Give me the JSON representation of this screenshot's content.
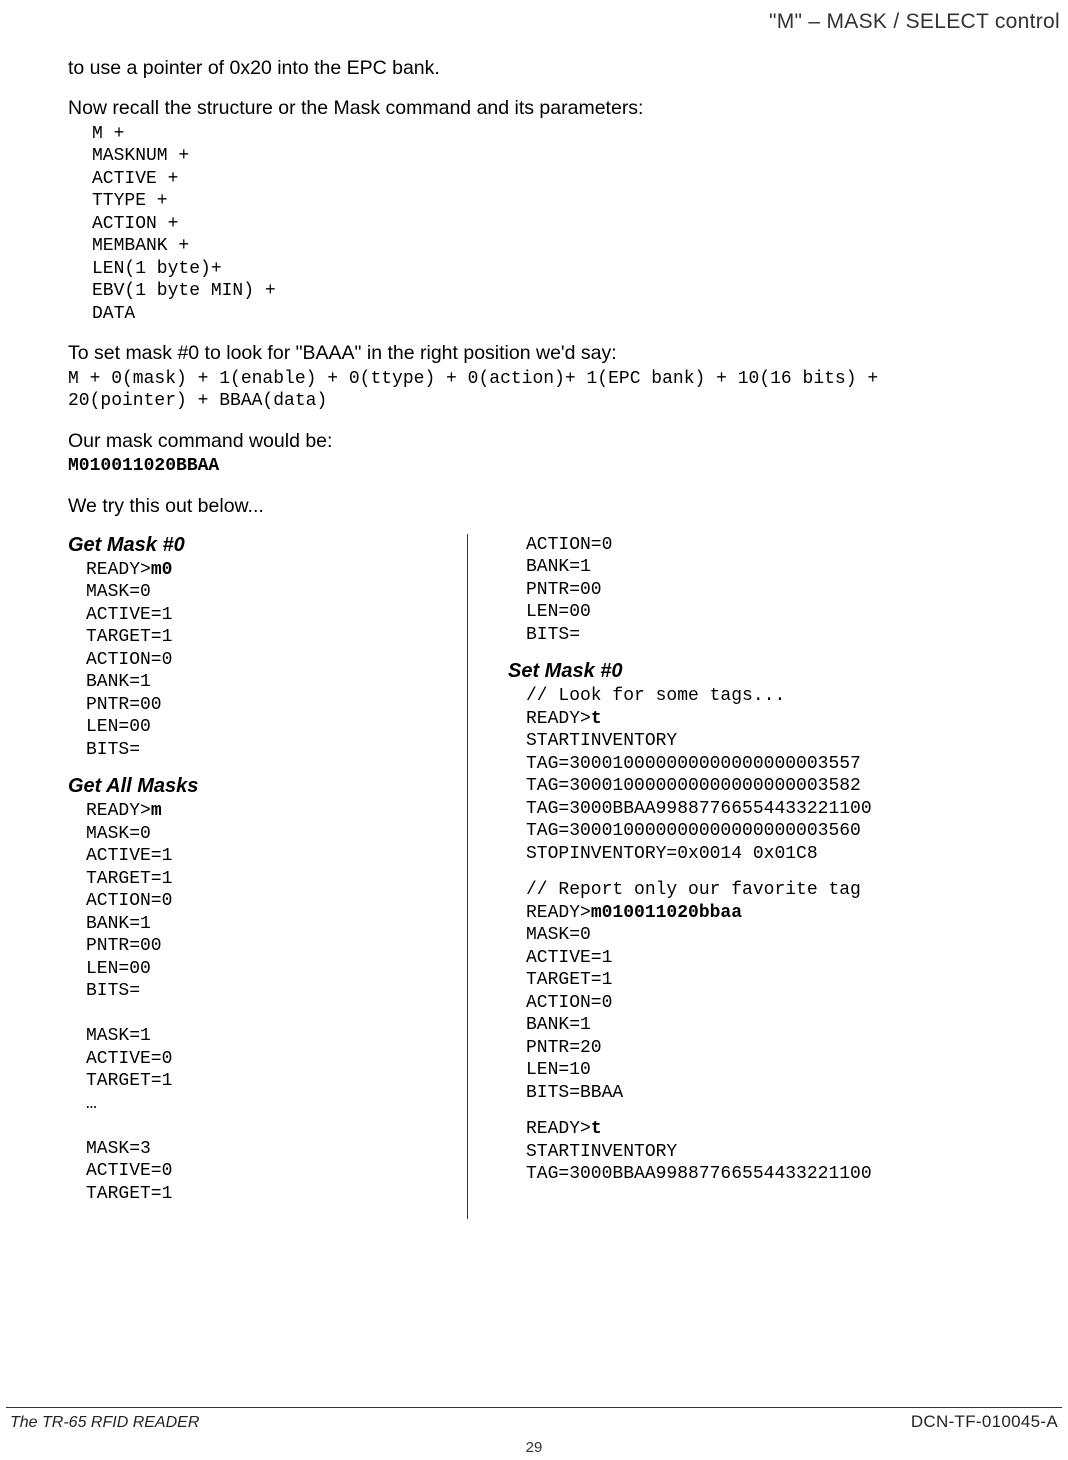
{
  "header": {
    "top_right": "\"M\" – MASK / SELECT control"
  },
  "intro": {
    "p1": "to use a pointer of 0x20 into the EPC bank.",
    "p2": "Now recall the structure or the Mask command and its parameters:",
    "struct_lines": "M +\nMASKNUM +\nACTIVE +\nTTYPE +\nACTION +\nMEMBANK +\nLEN(1 byte)+\nEBV(1 byte MIN) +\nDATA",
    "p3": "To set mask #0 to look for \"BAAA\" in the right position we'd say:",
    "set_line": "M + 0(mask) + 1(enable) + 0(ttype) + 0(action)+ 1(EPC bank) + 10(16 bits) +\n20(pointer) + BBAA(data)",
    "p4": "Our mask command would be:",
    "cmd": "M010011020BBAA",
    "p5": "We try this out below..."
  },
  "left": {
    "h1": "Get Mask #0",
    "block1_prefix": "READY>",
    "block1_bold": "m0",
    "block1_rest": "\nMASK=0\nACTIVE=1\nTARGET=1\nACTION=0\nBANK=1\nPNTR=00\nLEN=00\nBITS=",
    "h2": "Get All Masks",
    "block2_prefix": "READY>",
    "block2_bold": "m",
    "block2_rest": "\nMASK=0\nACTIVE=1\nTARGET=1\nACTION=0\nBANK=1\nPNTR=00\nLEN=00\nBITS=\n\nMASK=1\nACTIVE=0\nTARGET=1\n…\n\nMASK=3\nACTIVE=0\nTARGET=1"
  },
  "right": {
    "cont": "ACTION=0\nBANK=1\nPNTR=00\nLEN=00\nBITS=",
    "h1": "Set Mask #0",
    "b1_comment": "// Look for some tags...",
    "b1_prefix": "READY>",
    "b1_bold": "t",
    "b1_rest": "\nSTARTINVENTORY\nTAG=300010000000000000000003557\nTAG=300010000000000000000003582\nTAG=3000BBAA99887766554433221100\nTAG=300010000000000000000003560\nSTOPINVENTORY=0x0014 0x01C8",
    "b2_comment": "// Report only our favorite tag",
    "b2_prefix": "READY>",
    "b2_bold": "m010011020bbaa",
    "b2_rest": "\nMASK=0\nACTIVE=1\nTARGET=1\nACTION=0\nBANK=1\nPNTR=20\nLEN=10\nBITS=BBAA",
    "b3_prefix": "READY>",
    "b3_bold": "t",
    "b3_rest": "\nSTARTINVENTORY\nTAG=3000BBAA99887766554433221100"
  },
  "footer": {
    "left": "The TR-65 RFID READER",
    "right": "DCN-TF-010045-A",
    "page": "29"
  }
}
